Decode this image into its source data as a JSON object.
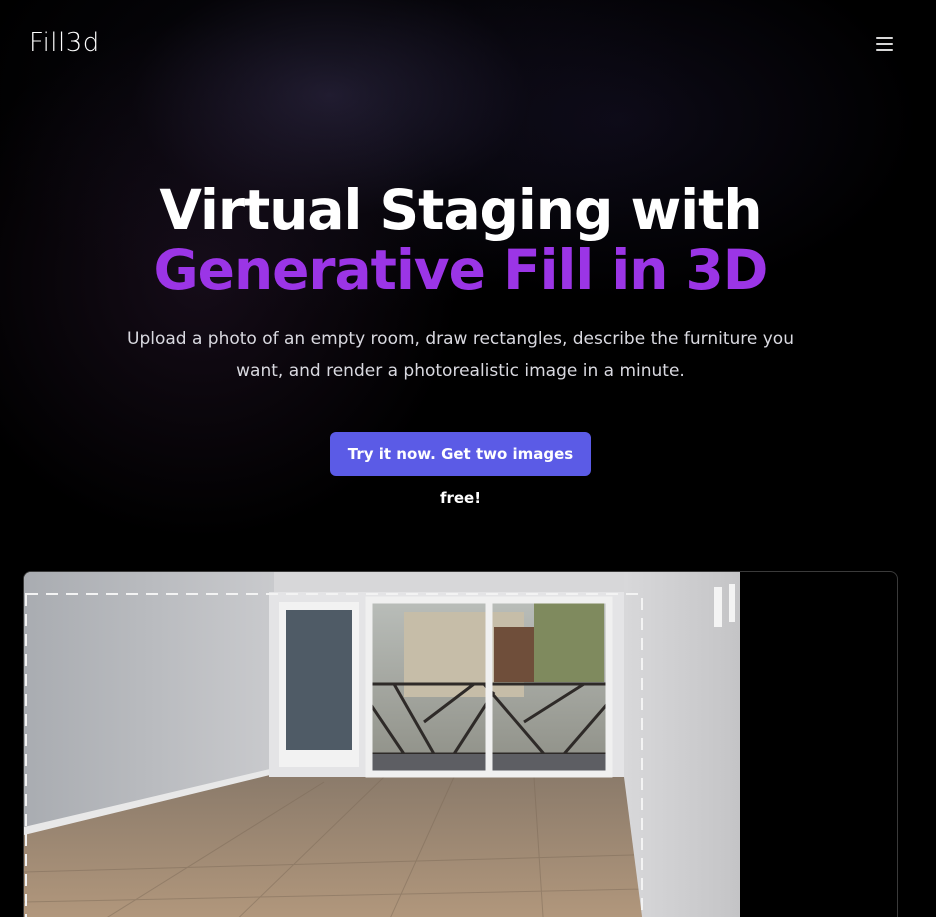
{
  "nav": {
    "logo_text": "Fill3d",
    "menu_icon": "hamburger-menu-icon"
  },
  "hero": {
    "headline_line1": "Virtual Staging with",
    "headline_line2": "Generative Fill in 3D",
    "subtitle": "Upload a photo of an empty room, draw rectangles, describe the furniture you want, and render a photorealistic image in a minute.",
    "cta_label": "Try it now. Get two images free!"
  },
  "colors": {
    "background": "#000000",
    "accent_purple": "#9b35e6",
    "cta_blue": "#5b5be6"
  }
}
